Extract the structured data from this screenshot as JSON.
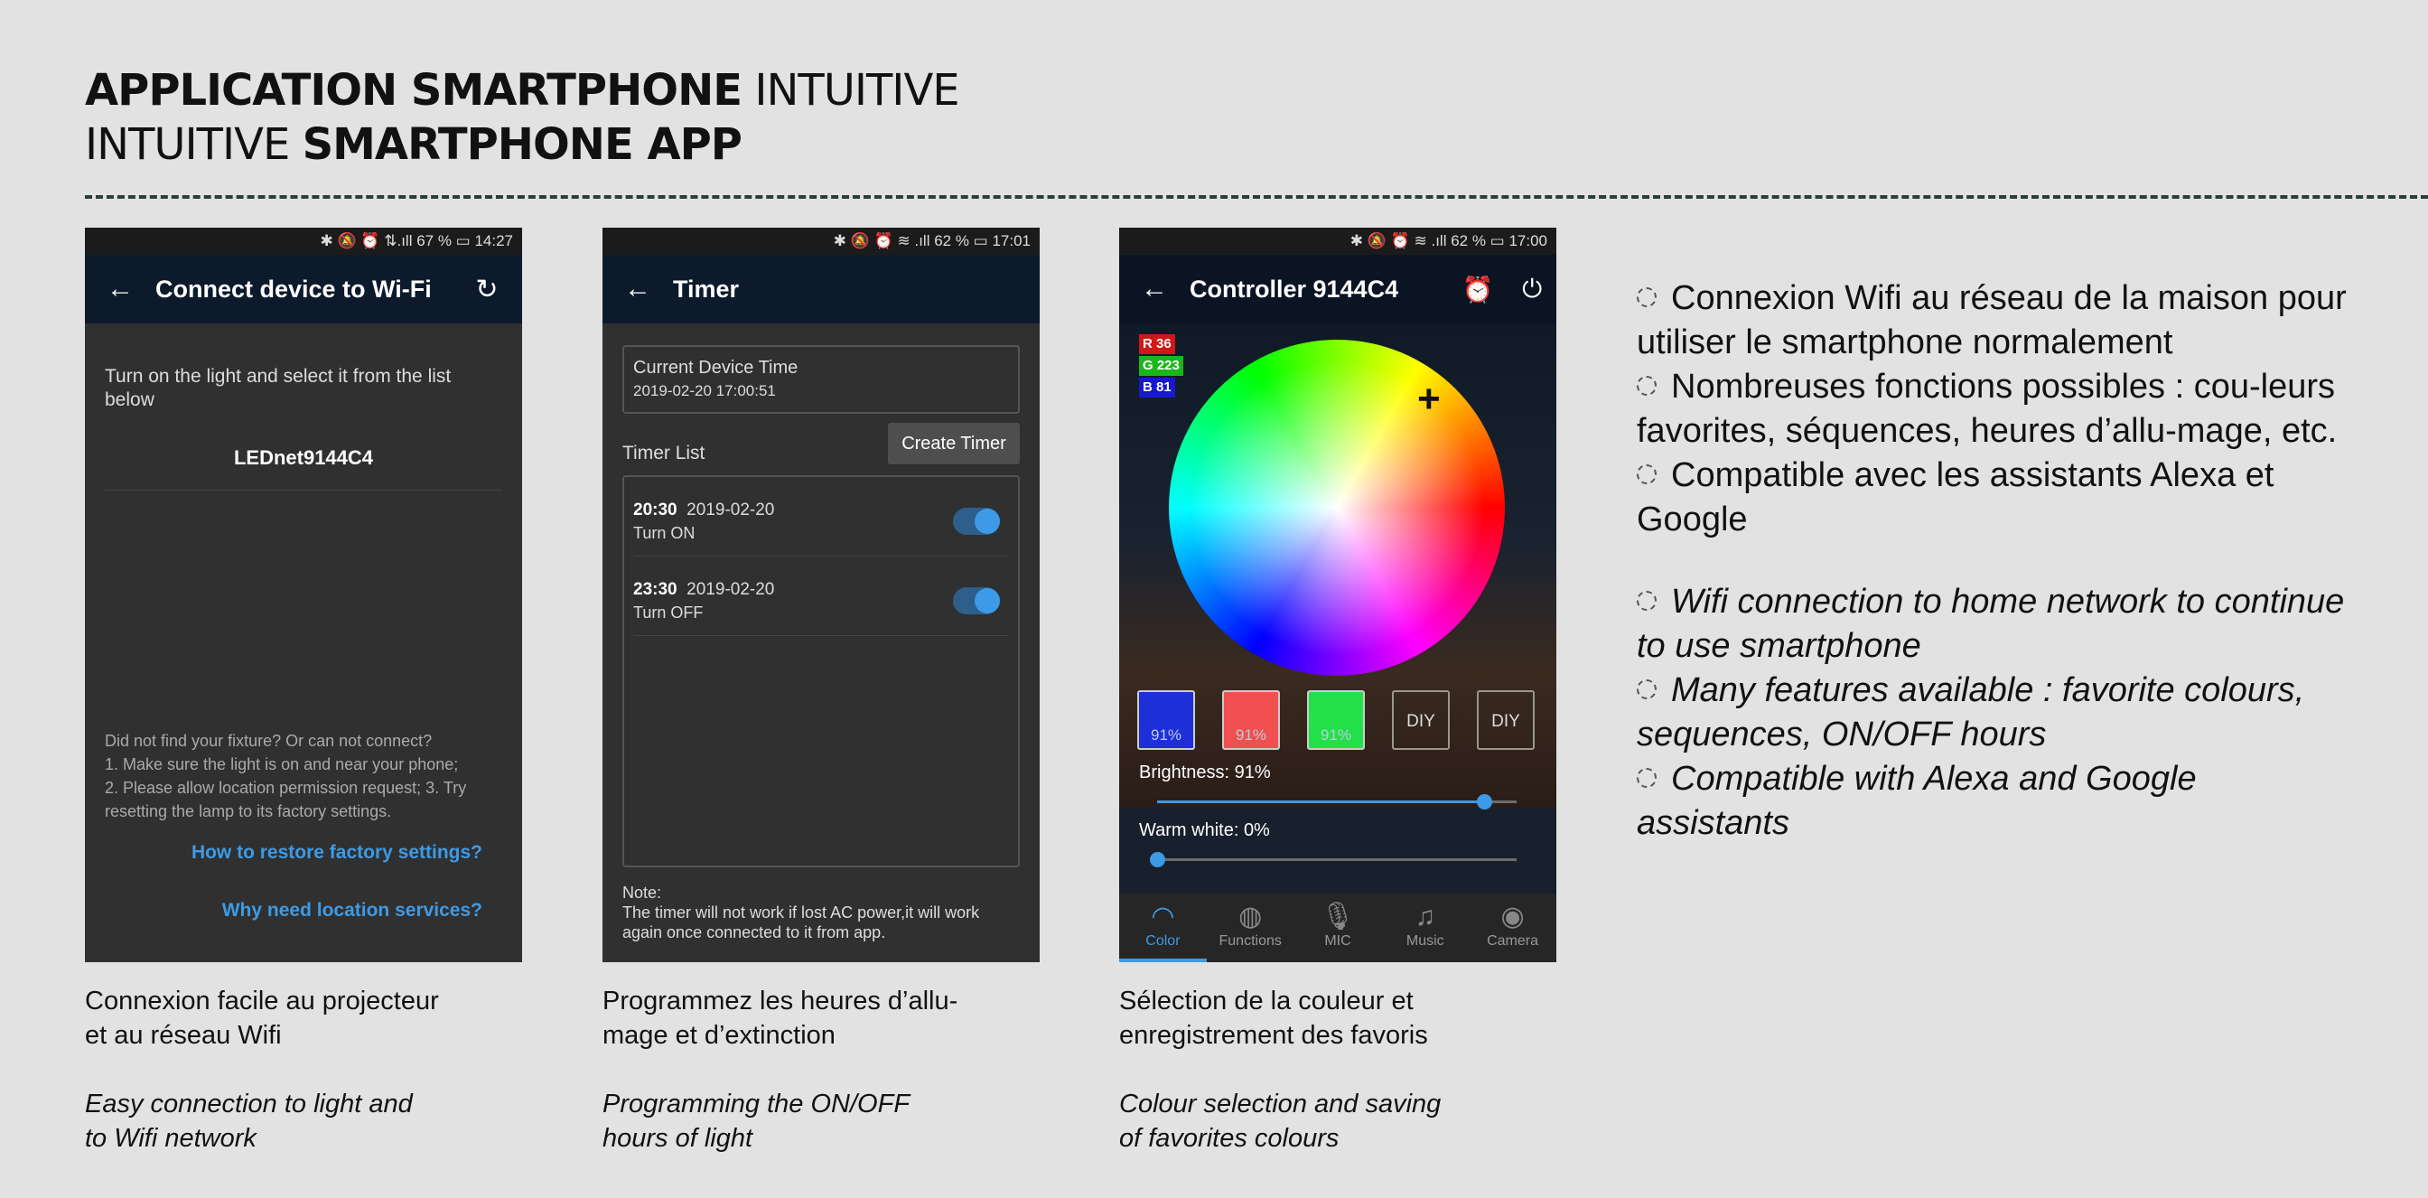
{
  "title": {
    "line1_bold": "APPLICATION SMARTPHONE",
    "line1_light": "INTUITIVE",
    "line2_light": "INTUITIVE",
    "line2_bold": "SMARTPHONE APP"
  },
  "phone1": {
    "status": "✱ 🔕 ⏰ ⇅.ıll 67 % ▭ 14:27",
    "title": "Connect device to Wi-Fi",
    "instruction": "Turn on the light and select it from the list below",
    "device": "LEDnet9144C4",
    "help": "Did not find your fixture? Or can not connect?\n1. Make sure the light is on and near your phone;\n2. Please allow location permission request; 3. Try resetting the lamp to its factory settings.",
    "link1": "How to restore factory settings?",
    "link2": "Why need location services?"
  },
  "phone2": {
    "status": "✱ 🔕 ⏰ ≋ .ıll 62 % ▭ 17:01",
    "title": "Timer",
    "current_label": "Current Device Time",
    "current_value": "2019-02-20 17:00:51",
    "create_button": "Create Timer",
    "list_label": "Timer List",
    "timers": [
      {
        "time": "20:30",
        "date": "2019-02-20",
        "state": "Turn ON",
        "enabled": true
      },
      {
        "time": "23:30",
        "date": "2019-02-20",
        "state": "Turn OFF",
        "enabled": true
      }
    ],
    "note_label": "Note:",
    "note": "The timer will not work if lost AC power,it will work again once connected to it from app."
  },
  "phone3": {
    "status": "✱ 🔕 ⏰ ≋ .ıll 62 % ▭ 17:00",
    "title": "Controller  9144C4",
    "r": "R 36",
    "g": "G 223",
    "b": "B 81",
    "swatches": [
      {
        "label": "91%",
        "color": "#1e2fd8"
      },
      {
        "label": "91%",
        "color": "#f05050"
      },
      {
        "label": "91%",
        "color": "#22e04a"
      },
      {
        "label": "DIY",
        "color": ""
      },
      {
        "label": "DIY",
        "color": ""
      }
    ],
    "brightness_label": "Brightness: 91%",
    "brightness": 0.91,
    "warm_label": "Warm white: 0%",
    "warm": 0.0,
    "tabs": [
      "Color",
      "Functions",
      "MIC",
      "Music",
      "Camera"
    ]
  },
  "captions": [
    {
      "fr": "Connexion facile au projecteur\net au réseau Wifi",
      "en": "Easy connection to light and\nto Wifi network"
    },
    {
      "fr": "Programmez les heures d’allu-\nmage et d’extinction",
      "en": "Programming the ON/OFF\nhours of  light"
    },
    {
      "fr": "Sélection de la couleur et\nenregistrement des favoris",
      "en": "Colour selection and saving\nof  favorites colours"
    }
  ],
  "bullets_fr": [
    "Connexion Wifi au réseau de la maison pour utiliser le smartphone normalement",
    "Nombreuses fonctions possibles : cou-leurs favorites, séquences, heures d’allu-mage, etc.",
    "Compatible avec les assistants Alexa et Google"
  ],
  "bullets_en": [
    "Wifi connection to home network to continue to use smartphone",
    "Many features available : favorite colours, sequences, ON/OFF hours",
    "Compatible with Alexa and Google assistants"
  ]
}
